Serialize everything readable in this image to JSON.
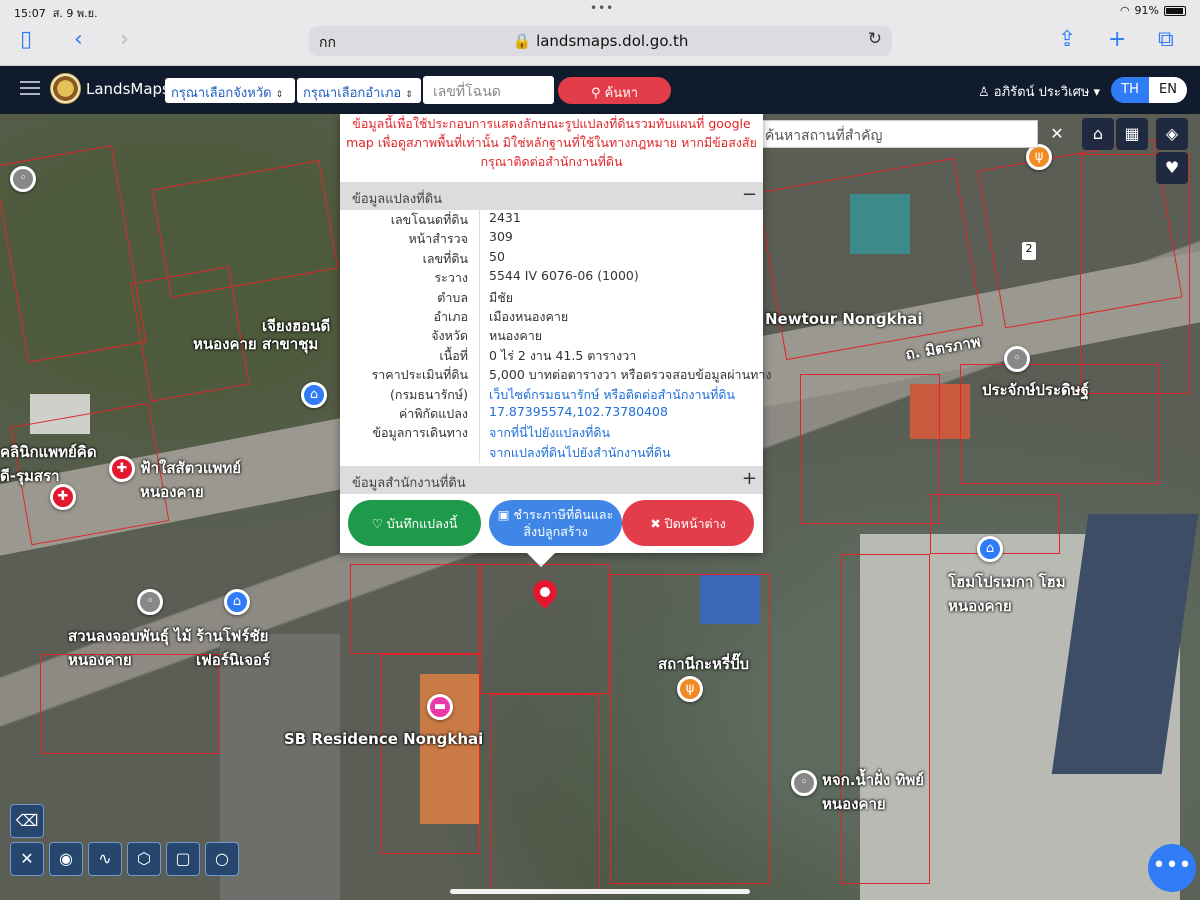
{
  "status": {
    "time": "15:07",
    "date": "ส. 9 พ.ย.",
    "dots": "•••",
    "battery": "91%"
  },
  "safari": {
    "tab_icon": "sidebar-icon",
    "aa": "กก",
    "url": "landsmaps.dol.go.th"
  },
  "nav": {
    "brand": "LandsMaps",
    "province_select": "กรุณาเลือกจังหวัด",
    "district_select": "กรุณาเลือกอำเภอ",
    "deed_placeholder": "เลขที่โฉนด",
    "search_label": "ค้นหา",
    "user": "อภิรัตน์ ประวิเศษ",
    "lang_th": "TH",
    "lang_en": "EN"
  },
  "map": {
    "place_search_placeholder": "ค้นหาสถานที่สำคัญ",
    "road_badge": "2",
    "labels": {
      "newtour": "Newtour Nongkhai",
      "mittraphap": "ถ. มิตรภาพ",
      "nongkhai_shop": "หนองคาย สาขาชุม",
      "xiang": "เจียงฮอนดี",
      "prachak": "ประจักษ์ประดิษฐ์",
      "clinic": "คลินิกแพทย์คิดดี-รุมสรา",
      "vet": "ฟ้าใสสัตวแพทย์ หนองคาย",
      "home_pro": "โฮมโปรเมกา โฮม หนองคาย",
      "garden": "สวนลงจอบพันธุ์ ไม้หนองคาย",
      "furniture": "ร้านโฟร์ชัย เฟอร์นิเจอร์",
      "sb": "SB Residence Nongkhai",
      "station": "สถานีกะหรี่ปั๊บ",
      "hotpot": "หจก.น้ำฝั่ง ทิพย์หนองคาย",
      "parcel_label": "จากที่นี่ไปยังแปลงที่ดิน"
    }
  },
  "popup": {
    "notice": "ข้อมูลนี้เพื่อใช้ประกอบการแสดงลักษณะรูปแปลงที่ดินรวมทับแผนที่ google map เพื่อดูสภาพพื้นที่เท่านั้น มิใช่หลักฐานที่ใช้ในทางกฎหมาย หากมีข้อสงสัย กรุณาติดต่อสำนักงานที่ดิน",
    "section_parcel": "ข้อมูลแปลงที่ดิน",
    "section_office": "ข้อมูลสำนักงานที่ดิน",
    "rows": [
      {
        "k": "เลขโฉนดที่ดิน",
        "v": "2431"
      },
      {
        "k": "หน้าสำรวจ",
        "v": "309"
      },
      {
        "k": "เลขที่ดิน",
        "v": "50"
      },
      {
        "k": "ระวาง",
        "v": "5544 IV 6076-06 (1000)"
      },
      {
        "k": "ตำบล",
        "v": "มีชัย"
      },
      {
        "k": "อำเภอ",
        "v": "เมืองหนองคาย"
      },
      {
        "k": "จังหวัด",
        "v": "หนองคาย"
      },
      {
        "k": "เนื้อที่",
        "v": "0 ไร่ 2 งาน 41.5 ตารางวา"
      },
      {
        "k": "ราคาประเมินที่ดิน",
        "v": "5,000 บาทต่อตารางวา หรือตรวจสอบข้อมูลผ่านทาง"
      },
      {
        "k": "(กรมธนารักษ์)",
        "v": "เว็บไซต์กรมธนารักษ์ หรือติดต่อสำนักงานที่ดิน"
      },
      {
        "k": "ค่าพิกัดแปลง",
        "v": "17.87395574,102.73780408"
      },
      {
        "k": "ข้อมูลการเดินทาง",
        "v": "จากที่นี่ไปยังแปลงที่ดิน"
      },
      {
        "k": "",
        "v": "จากแปลงที่ดินไปยังสำนักงานที่ดิน"
      }
    ],
    "btn_save": "บันทึกแปลงนี้",
    "btn_pay": "ชำระภาษีที่ดินและ สิ่งปลูกสร้าง",
    "btn_close": "ปิดหน้าต่าง"
  },
  "colors": {
    "parcel": "#e0262a",
    "nav_bg": "#101b2e",
    "accent": "#2f7cf6",
    "danger": "#e43d4a",
    "success": "#1e9b4a"
  }
}
